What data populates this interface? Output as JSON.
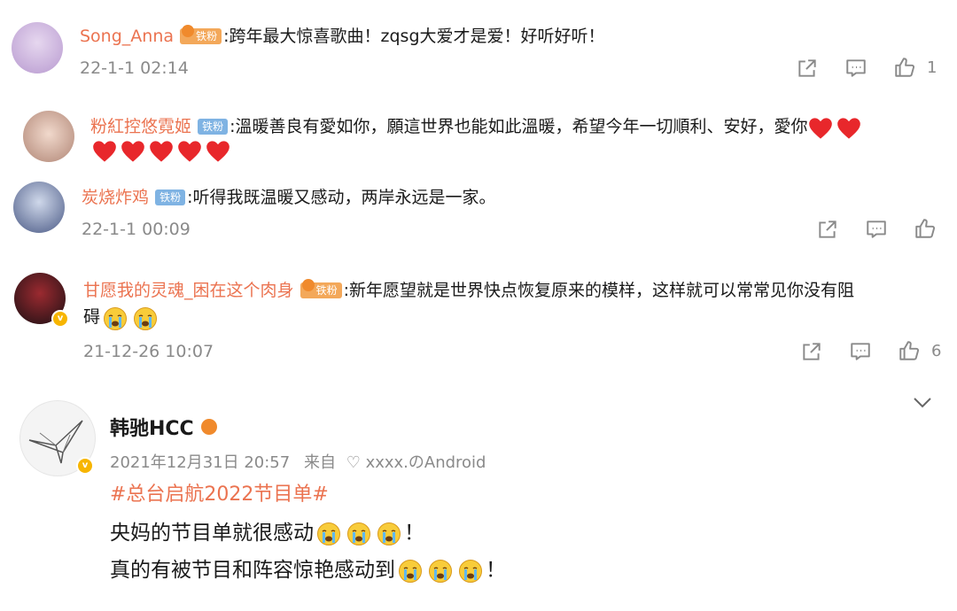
{
  "comments": [
    {
      "username": "Song_Anna",
      "badge": "铁粉",
      "text": ":跨年最大惊喜歌曲！zqsg大爱才是爱！好听好听！",
      "time": "22-1-1 02:14",
      "like_count": "1"
    },
    {
      "username": "粉紅控悠霓姬",
      "badge": "铁粉",
      "text": ":溫暖善良有愛如你，願這世界也能如此溫暖，希望今年一切順利、安好，愛你"
    },
    {
      "username": "炭烧炸鸡",
      "badge": "铁粉",
      "text": ":听得我既温暖又感动，两岸永远是一家。",
      "time": "22-1-1 00:09"
    },
    {
      "username": "甘愿我的灵魂_困在这个肉身",
      "badge": "铁粉",
      "text_line1": ":新年愿望就是世界快点恢复原来的模样，这样就可以常常见你没有阻",
      "text_line2": "碍",
      "time": "21-12-26 10:07",
      "like_count": "6"
    }
  ],
  "post": {
    "author": "韩驰HCC",
    "time": "2021年12月31日 20:57",
    "source_prefix": "来自",
    "source": "xxxx.のAndroid",
    "topic": "#总台启航2022节目单#",
    "line1": "央妈的节目单就很感动",
    "line1_end": "！",
    "line2": "真的有被节目和阵容惊艳感动到",
    "line2_end": "！"
  },
  "icons": {
    "share": "share-icon",
    "comment": "comment-icon",
    "like": "like-icon",
    "expand": "chevron-down-icon"
  },
  "colors": {
    "username": "#eb7350",
    "meta": "#8a8a8a",
    "badge_blue": "#7fb3e3",
    "badge_gold": "#f3a85a",
    "heart": "#e8272b"
  }
}
